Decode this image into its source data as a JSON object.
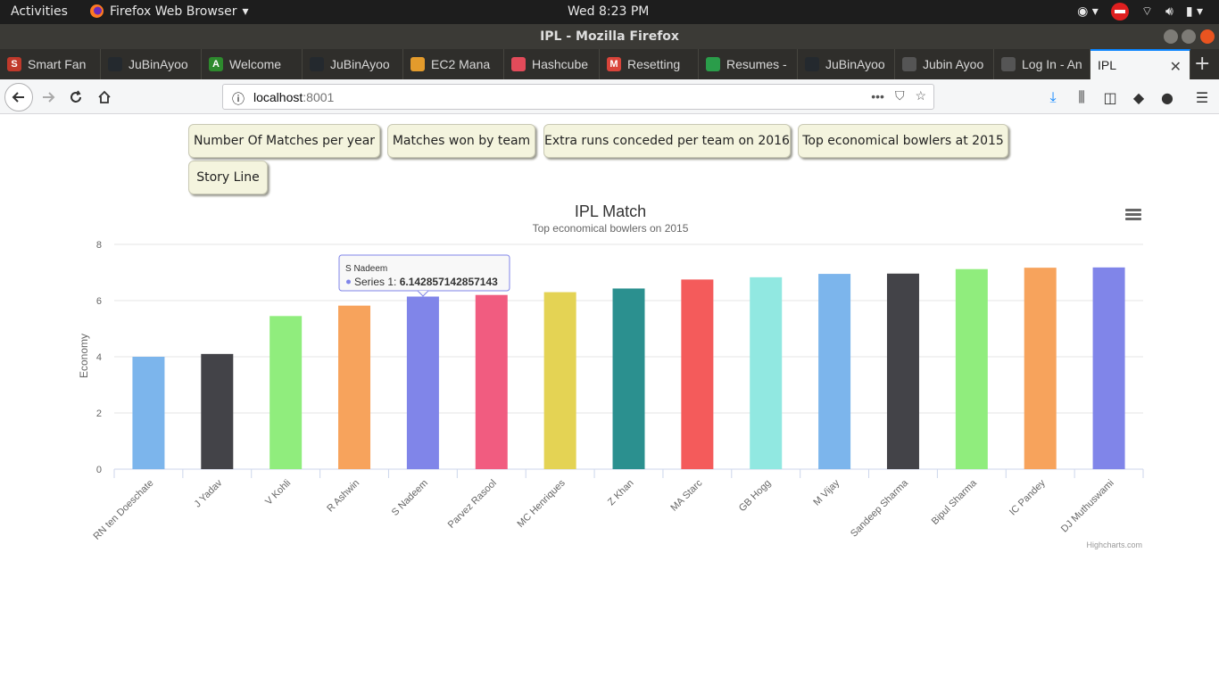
{
  "topbar": {
    "activities": "Activities",
    "app_menu": "Firefox Web Browser",
    "clock": "Wed  8:23 PM"
  },
  "window": {
    "title": "IPL - Mozilla Firefox"
  },
  "tabs": [
    {
      "label": "Smart Fan",
      "fav": "S",
      "color": "#c0392b"
    },
    {
      "label": "JuBinAyoo",
      "fav": "",
      "color": "#24292e"
    },
    {
      "label": "Welcome",
      "fav": "A",
      "color": "#2d8a2d"
    },
    {
      "label": "JuBinAyoo",
      "fav": "",
      "color": "#24292e"
    },
    {
      "label": "EC2 Mana",
      "fav": "",
      "color": "#e39b2c"
    },
    {
      "label": "Hashcube",
      "fav": "",
      "color": "#e24b5a"
    },
    {
      "label": "Resetting",
      "fav": "M",
      "color": "#d9443a"
    },
    {
      "label": "Resumes -",
      "fav": "",
      "color": "#2a9d4a"
    },
    {
      "label": "JuBinAyoo",
      "fav": "",
      "color": "#24292e"
    },
    {
      "label": "Jubin Ayoo",
      "fav": "",
      "color": "#555555"
    },
    {
      "label": "Log In - An",
      "fav": "",
      "color": "#555555"
    },
    {
      "label": "IPL",
      "fav": "",
      "color": ""
    }
  ],
  "url": {
    "host": "localhost",
    "port": ":8001"
  },
  "buttons": [
    "Number Of Matches per year",
    "Matches won by team",
    "Extra runs conceded per team on 2016",
    "Top economical bowlers at 2015",
    "Story Line"
  ],
  "chart_data": {
    "type": "bar",
    "title": "IPL Match",
    "subtitle": "Top economical bowlers on 2015",
    "ylabel": "Economy",
    "ylim": [
      0,
      8
    ],
    "yticks": [
      0,
      2,
      4,
      6,
      8
    ],
    "categories": [
      "RN ten Doeschate",
      "J Yadav",
      "V Kohli",
      "R Ashwin",
      "S Nadeem",
      "Parvez Rasool",
      "MC Henriques",
      "Z Khan",
      "MA Starc",
      "GB Hogg",
      "M Vijay",
      "Sandeep Sharma",
      "Bipul Sharma",
      "IC Pandey",
      "DJ Muthuswami"
    ],
    "values": [
      4.0,
      4.1,
      5.45,
      5.82,
      6.142857142857143,
      6.2,
      6.3,
      6.43,
      6.75,
      6.83,
      6.95,
      6.96,
      7.12,
      7.17,
      7.18
    ],
    "colors": [
      "#7cb5ec",
      "#434348",
      "#90ed7d",
      "#f7a35c",
      "#8085e9",
      "#f15c80",
      "#e4d354",
      "#2b908f",
      "#f45b5b",
      "#91e8e1",
      "#7cb5ec",
      "#434348",
      "#90ed7d",
      "#f7a35c",
      "#8085e9"
    ],
    "tooltip": {
      "category": "S Nadeem",
      "series": "Series 1:",
      "value": "6.142857142857143"
    },
    "credits": "Highcharts.com",
    "grid": true
  }
}
